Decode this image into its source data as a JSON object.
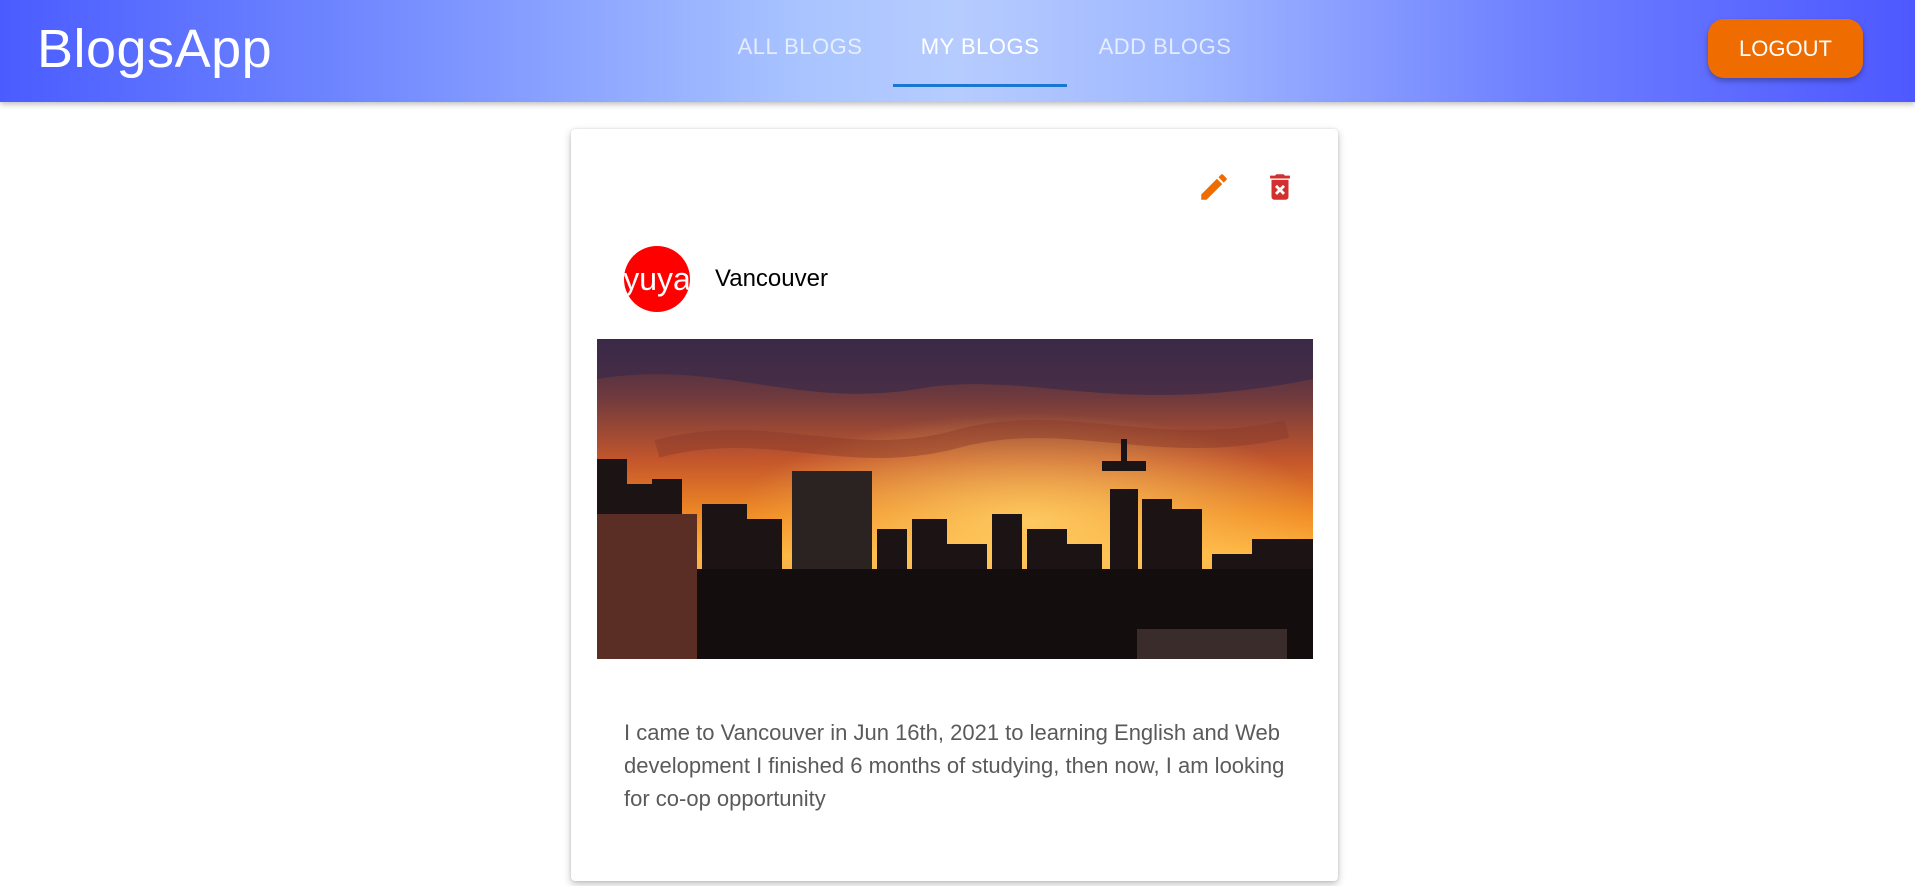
{
  "app": {
    "brand": "BlogsApp"
  },
  "nav": {
    "tabs": [
      {
        "label": "ALL BLOGS"
      },
      {
        "label": "MY BLOGS"
      },
      {
        "label": "ADD BLOGS"
      }
    ],
    "active_tab": "MY BLOGS",
    "logout_label": "LOGOUT"
  },
  "blog": {
    "avatar_text": "yuya",
    "title": "Vancouver",
    "image_icon": "city-skyline-sunset-photo",
    "description": "I came to Vancouver in Jun 16th, 2021 to learning English and Web development I finished 6 months of studying, then now, I am looking for co-op opportunity"
  },
  "colors": {
    "appbar_gradient": [
      "#4a5cff",
      "#b6ccff",
      "#4e58ff"
    ],
    "logout_button": "#ef6c00",
    "tab_indicator": "#1976d2",
    "edit_icon": "#ef6c00",
    "delete_icon": "#d32f2f",
    "avatar": "#ff0000"
  },
  "icons": {
    "edit": "pencil-icon",
    "delete": "trash-icon"
  }
}
